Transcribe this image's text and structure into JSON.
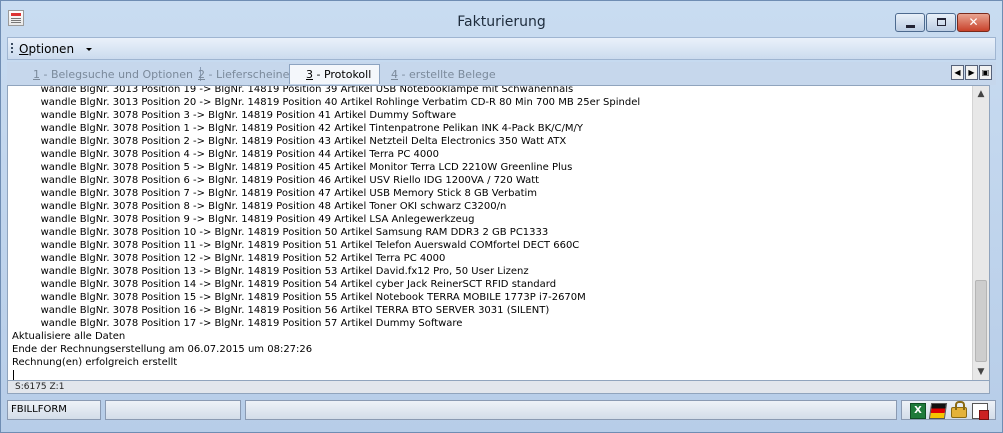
{
  "window": {
    "title": "Fakturierung"
  },
  "menu": {
    "optionen_u": "O",
    "optionen_rest": "ptionen"
  },
  "tabs": [
    {
      "num": "1",
      "label": " - Belegsuche und Optionen"
    },
    {
      "num": "2",
      "label": " - Lieferscheine"
    },
    {
      "num": "3",
      "label": " - Protokoll"
    },
    {
      "num": "4",
      "label": " - erstellte Belege"
    }
  ],
  "log_lines": [
    "         wandle BlgNr. 3013 Position 19 -> BlgNr. 14819 Position 39 Artikel USB Notebooklampe mit Schwanenhals",
    "         wandle BlgNr. 3013 Position 20 -> BlgNr. 14819 Position 40 Artikel Rohlinge Verbatim CD-R 80 Min 700 MB 25er Spindel",
    "         wandle BlgNr. 3078 Position 3 -> BlgNr. 14819 Position 41 Artikel Dummy Software",
    "         wandle BlgNr. 3078 Position 1 -> BlgNr. 14819 Position 42 Artikel Tintenpatrone Pelikan INK 4-Pack BK/C/M/Y",
    "         wandle BlgNr. 3078 Position 2 -> BlgNr. 14819 Position 43 Artikel Netzteil Delta Electronics 350 Watt ATX",
    "         wandle BlgNr. 3078 Position 4 -> BlgNr. 14819 Position 44 Artikel Terra PC 4000",
    "         wandle BlgNr. 3078 Position 5 -> BlgNr. 14819 Position 45 Artikel Monitor Terra LCD 2210W Greenline Plus",
    "         wandle BlgNr. 3078 Position 6 -> BlgNr. 14819 Position 46 Artikel USV Riello IDG 1200VA / 720 Watt",
    "         wandle BlgNr. 3078 Position 7 -> BlgNr. 14819 Position 47 Artikel USB Memory Stick 8 GB Verbatim",
    "         wandle BlgNr. 3078 Position 8 -> BlgNr. 14819 Position 48 Artikel Toner OKI schwarz C3200/n",
    "         wandle BlgNr. 3078 Position 9 -> BlgNr. 14819 Position 49 Artikel LSA Anlegewerkzeug",
    "         wandle BlgNr. 3078 Position 10 -> BlgNr. 14819 Position 50 Artikel Samsung RAM DDR3 2 GB PC1333",
    "         wandle BlgNr. 3078 Position 11 -> BlgNr. 14819 Position 51 Artikel Telefon Auerswald COMfortel DECT 660C",
    "         wandle BlgNr. 3078 Position 12 -> BlgNr. 14819 Position 52 Artikel Terra PC 4000",
    "         wandle BlgNr. 3078 Position 13 -> BlgNr. 14819 Position 53 Artikel David.fx12 Pro, 50 User Lizenz",
    "         wandle BlgNr. 3078 Position 14 -> BlgNr. 14819 Position 54 Artikel cyber Jack ReinerSCT RFID standard",
    "         wandle BlgNr. 3078 Position 15 -> BlgNr. 14819 Position 55 Artikel Notebook TERRA MOBILE 1773P i7-2670M",
    "         wandle BlgNr. 3078 Position 16 -> BlgNr. 14819 Position 56 Artikel TERRA BTO SERVER 3031 (SILENT)",
    "         wandle BlgNr. 3078 Position 17 -> BlgNr. 14819 Position 57 Artikel Dummy Software",
    "Aktualisiere alle Daten",
    "Ende der Rechnungserstellung am 06.07.2015 um 08:27:26",
    "Rechnung(en) erfolgreich erstellt"
  ],
  "info": {
    "position": "S:6175   Z:1"
  },
  "status": {
    "form": "FBILLFORM"
  },
  "icons": {
    "excel": "excel-icon",
    "flag": "german-flag-icon",
    "lock": "lock-icon",
    "doc": "document-icon"
  },
  "colors": {
    "frame": "#bcd1e8",
    "close": "#c8412a"
  }
}
